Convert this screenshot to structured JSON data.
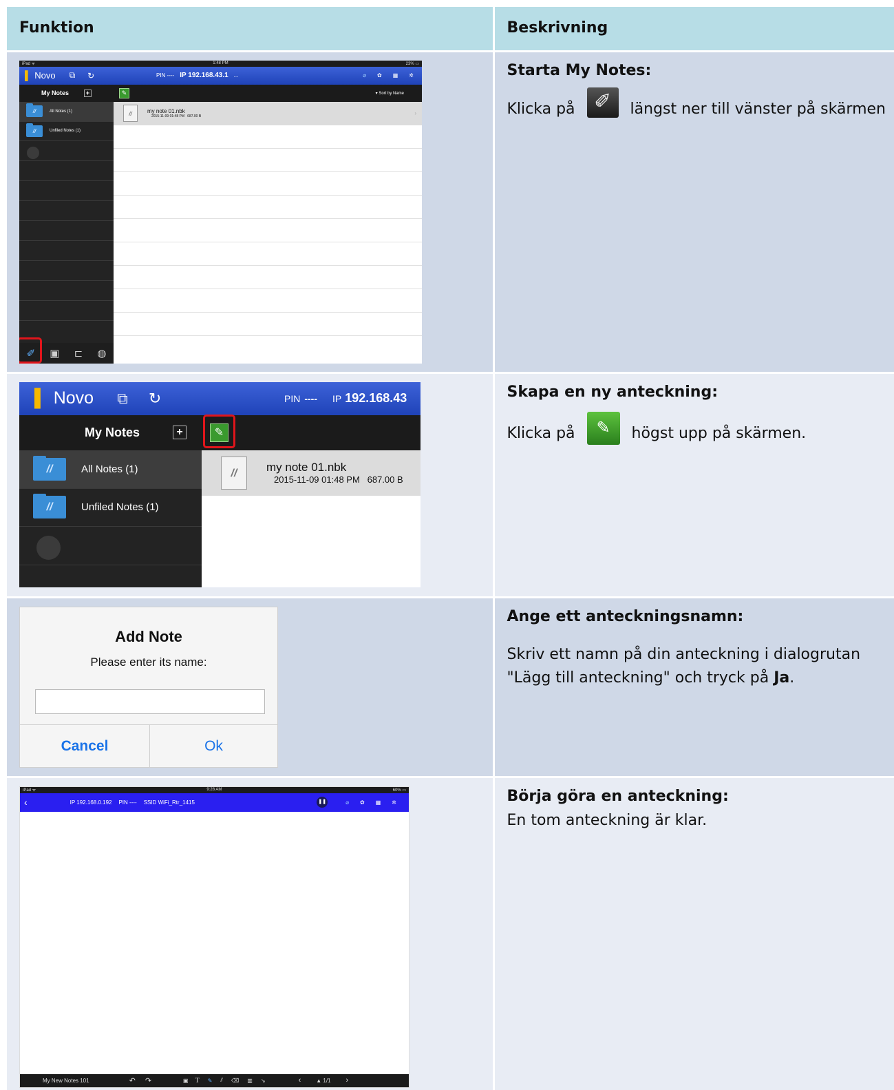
{
  "table": {
    "headers": {
      "function": "Funktion",
      "description": "Beskrivning"
    },
    "rows": [
      {
        "title": "Starta My Notes:",
        "text_before": "Klicka på",
        "text_after": "längst ner till vänster på skärmen"
      },
      {
        "title": "Skapa en ny anteckning:",
        "text_before": "Klicka på",
        "text_after": "högst upp på skärmen."
      },
      {
        "title": "Ange ett anteckningsnamn:",
        "text_before": "Skriv ett namn på din anteckning i dialogrutan \"Lägg till anteckning\" och tryck på ",
        "text_bold": "Ja",
        "text_after": "."
      },
      {
        "title": "Börja göra en anteckning:",
        "text": "En tom anteckning är klar."
      }
    ]
  },
  "shot1": {
    "status_left": "iPad ᯤ",
    "status_time": "1:48 PM",
    "status_right": "23% ▭",
    "app_name": "Novo",
    "pin": "PIN ----",
    "ip": "IP 192.168.43.1",
    "ellipsis": "...",
    "my_notes": "My Notes",
    "sort": "▾ Sort by Name",
    "folders": [
      "All Notes (1)",
      "Unfiled Notes (1)"
    ],
    "note_name": "my note 01.nbk",
    "note_meta": "2015-11-09 01:48 PM   687.00 B"
  },
  "shot2": {
    "app_name": "Novo",
    "pin_label": "PIN",
    "pin_value": "----",
    "ip_label": "IP",
    "ip": "192.168.43",
    "my_notes": "My Notes",
    "folders": [
      "All Notes (1)",
      "Unfiled Notes (1)"
    ],
    "note_name": "my note 01.nbk",
    "note_meta": "2015-11-09 01:48 PM   687.00 B"
  },
  "dialog": {
    "title": "Add Note",
    "message": "Please enter its name:",
    "input_value": "",
    "cancel": "Cancel",
    "ok": "Ok"
  },
  "shot4": {
    "status_left": "iPad ᯤ",
    "status_time": "9:28 AM",
    "status_right": "60% ▭",
    "ip": "IP 192.168.0.192",
    "pin": "PIN ----",
    "ssid": "SSID WiFi_Rtr_1415",
    "note_title": "My New Notes 101",
    "page": "▲ 1/1"
  }
}
